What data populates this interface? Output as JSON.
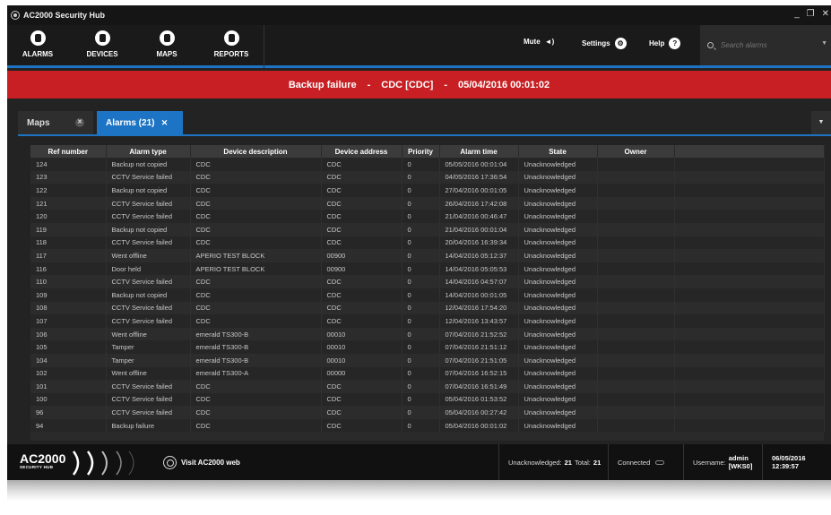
{
  "window": {
    "title": "AC2000 Security Hub",
    "controls": [
      "_",
      "❐",
      "✕"
    ]
  },
  "nav": {
    "items": [
      {
        "label": "ALARMS",
        "icon": "alarm-bell-icon"
      },
      {
        "label": "DEVICES",
        "icon": "device-icon"
      },
      {
        "label": "MAPS",
        "icon": "map-icon"
      },
      {
        "label": "REPORTS",
        "icon": "report-icon"
      }
    ],
    "mute_label": "Mute",
    "settings_label": "Settings",
    "help_label": "Help",
    "search_placeholder": "Search alarms"
  },
  "banner": {
    "alarm": "Backup failure",
    "sep1": "-",
    "device": "CDC [CDC]",
    "sep2": "-",
    "time": "05/04/2016 00:01:02"
  },
  "tabs": [
    {
      "label": "Maps",
      "active": false
    },
    {
      "label": "Alarms (21)",
      "active": true
    }
  ],
  "table": {
    "columns": [
      "Ref number",
      "Alarm type",
      "Device description",
      "Device address",
      "Priority",
      "Alarm time",
      "State",
      "Owner"
    ],
    "rows": [
      [
        "124",
        "Backup not copied",
        "CDC",
        "CDC",
        "0",
        "05/05/2016 00:01:04",
        "Unacknowledged",
        ""
      ],
      [
        "123",
        "CCTV Service failed",
        "CDC",
        "CDC",
        "0",
        "04/05/2016 17:36:54",
        "Unacknowledged",
        ""
      ],
      [
        "122",
        "Backup not copied",
        "CDC",
        "CDC",
        "0",
        "27/04/2016 00:01:05",
        "Unacknowledged",
        ""
      ],
      [
        "121",
        "CCTV Service failed",
        "CDC",
        "CDC",
        "0",
        "26/04/2016 17:42:08",
        "Unacknowledged",
        ""
      ],
      [
        "120",
        "CCTV Service failed",
        "CDC",
        "CDC",
        "0",
        "21/04/2016 00:46:47",
        "Unacknowledged",
        ""
      ],
      [
        "119",
        "Backup not copied",
        "CDC",
        "CDC",
        "0",
        "21/04/2016 00:01:04",
        "Unacknowledged",
        ""
      ],
      [
        "118",
        "CCTV Service failed",
        "CDC",
        "CDC",
        "0",
        "20/04/2016 16:39:34",
        "Unacknowledged",
        ""
      ],
      [
        "117",
        "Went offline",
        "APERIO TEST BLOCK",
        "00900",
        "0",
        "14/04/2016 05:12:37",
        "Unacknowledged",
        ""
      ],
      [
        "116",
        "Door held",
        "APERIO TEST BLOCK",
        "00900",
        "0",
        "14/04/2016 05:05:53",
        "Unacknowledged",
        ""
      ],
      [
        "110",
        "CCTV Service failed",
        "CDC",
        "CDC",
        "0",
        "14/04/2016 04:57:07",
        "Unacknowledged",
        ""
      ],
      [
        "109",
        "Backup not copied",
        "CDC",
        "CDC",
        "0",
        "14/04/2016 00:01:05",
        "Unacknowledged",
        ""
      ],
      [
        "108",
        "CCTV Service failed",
        "CDC",
        "CDC",
        "0",
        "12/04/2016 17:54:20",
        "Unacknowledged",
        ""
      ],
      [
        "107",
        "CCTV Service failed",
        "CDC",
        "CDC",
        "0",
        "12/04/2016 13:43:57",
        "Unacknowledged",
        ""
      ],
      [
        "106",
        "Went offline",
        "emerald TS300-B",
        "00010",
        "0",
        "07/04/2016 21:52:52",
        "Unacknowledged",
        ""
      ],
      [
        "105",
        "Tamper",
        "emerald TS300-B",
        "00010",
        "0",
        "07/04/2016 21:51:12",
        "Unacknowledged",
        ""
      ],
      [
        "104",
        "Tamper",
        "emerald TS300-B",
        "00010",
        "0",
        "07/04/2016 21:51:05",
        "Unacknowledged",
        ""
      ],
      [
        "102",
        "Went offline",
        "emerald TS300-A",
        "00000",
        "0",
        "07/04/2016 16:52:15",
        "Unacknowledged",
        ""
      ],
      [
        "101",
        "CCTV Service failed",
        "CDC",
        "CDC",
        "0",
        "07/04/2016 16:51:49",
        "Unacknowledged",
        ""
      ],
      [
        "100",
        "CCTV Service failed",
        "CDC",
        "CDC",
        "0",
        "05/04/2016 01:53:52",
        "Unacknowledged",
        ""
      ],
      [
        "96",
        "CCTV Service failed",
        "CDC",
        "CDC",
        "0",
        "05/04/2016 00:27:42",
        "Unacknowledged",
        ""
      ],
      [
        "94",
        "Backup failure",
        "CDC",
        "CDC",
        "0",
        "05/04/2016 00:01:02",
        "Unacknowledged",
        ""
      ]
    ]
  },
  "status": {
    "brand": "AC2000",
    "brand_sub": "SECURITY HUB",
    "visit_label": "Visit AC2000 web",
    "unack_label": "Unacknowledged:",
    "unack_count": "21",
    "total_label": "Total:",
    "total_count": "21",
    "connected_label": "Connected",
    "username_label": "Username:",
    "username_value": "admin [WKS0]",
    "datetime": "06/05/2016 12:39:57"
  },
  "colors": {
    "accent": "#1e74c4",
    "banner": "#c71f23",
    "background": "#232323"
  }
}
